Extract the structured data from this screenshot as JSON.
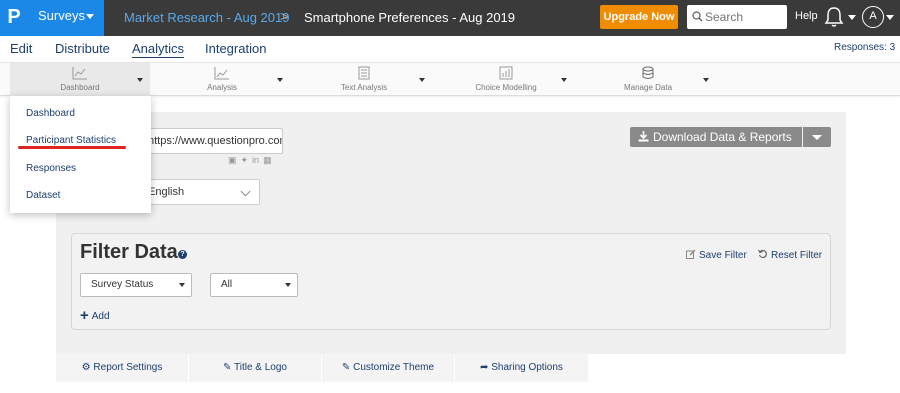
{
  "topbar": {
    "logo": "P",
    "surveys_label": "Surveys",
    "breadcrumb_folder": "Market Research - Aug 2019",
    "breadcrumb_separator": ">",
    "breadcrumb_survey": "Smartphone Preferences - Aug 2019",
    "upgrade_label": "Upgrade Now",
    "search_placeholder": "Search",
    "help_label": "Help",
    "avatar_letter": "A"
  },
  "mainnav": {
    "items": [
      "Edit",
      "Distribute",
      "Analytics",
      "Integration"
    ],
    "active": "Analytics",
    "responses_label": "Responses: 3"
  },
  "toolbar": {
    "tools": [
      {
        "label": "Dashboard",
        "icon": "line-chart-icon"
      },
      {
        "label": "Analysis",
        "icon": "chart-icon"
      },
      {
        "label": "Text Analysis",
        "icon": "text-analysis-icon"
      },
      {
        "label": "Choice Modelling",
        "icon": "bar-chart-icon"
      },
      {
        "label": "Manage Data",
        "icon": "database-icon"
      }
    ]
  },
  "dashboard_menu": {
    "items": [
      "Dashboard",
      "Participant Statistics",
      "Responses",
      "Dataset"
    ],
    "highlighted": "Participant Statistics"
  },
  "report": {
    "url_value": "https://www.questionpro.com",
    "language_value": "English",
    "download_label": "Download Data & Reports",
    "share_icons": [
      "facebook-icon",
      "twitter-icon",
      "linkedin-icon",
      "qr-code-icon"
    ]
  },
  "filter": {
    "title": "Filter Data",
    "help_symbol": "?",
    "save_label": "Save Filter",
    "reset_label": "Reset Filter",
    "status_select": "Survey Status",
    "value_select": "All",
    "add_label": "Add"
  },
  "bottom_tabs": [
    "Report Settings",
    "Title & Logo",
    "Customize Theme",
    "Sharing Options"
  ],
  "colors": {
    "topbar_bg": "#3a3a3a",
    "brand_blue": "#1b87e6",
    "upgrade_orange": "#f08c00",
    "nav_text": "#1c3f6e",
    "highlight_red": "#e32121"
  }
}
